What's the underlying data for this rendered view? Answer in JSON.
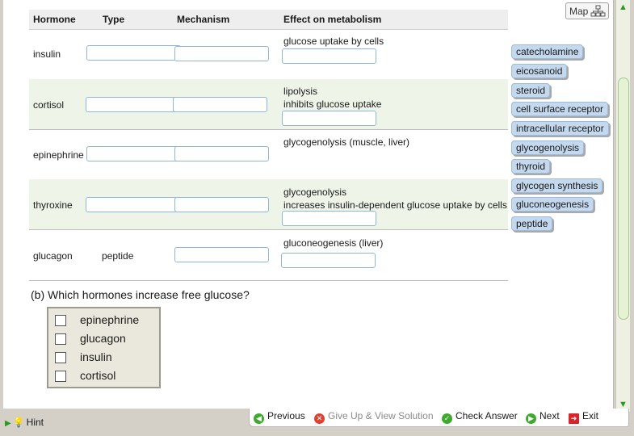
{
  "map_label": "Map",
  "table": {
    "headers": {
      "hormone": "Hormone",
      "type": "Type",
      "mechanism": "Mechanism",
      "effect": "Effect on metabolism"
    },
    "rows": [
      {
        "hormone": "insulin",
        "type": "",
        "effects": [
          "glucose uptake by cells"
        ]
      },
      {
        "hormone": "cortisol",
        "type": "",
        "effects": [
          "lipolysis",
          "inhibits glucose uptake"
        ]
      },
      {
        "hormone": "epinephrine",
        "type": "",
        "effects": [
          "glycogenolysis (muscle, liver)"
        ]
      },
      {
        "hormone": "thyroxine",
        "type": "",
        "effects": [
          "glycogenolysis",
          "increases insulin-dependent glucose uptake by cells"
        ]
      },
      {
        "hormone": "glucagon",
        "type": "peptide",
        "effects": [
          "gluconeogenesis (liver)"
        ]
      }
    ]
  },
  "tiles": [
    "catecholamine",
    "eicosanoid",
    "steroid",
    "cell surface receptor",
    "intracellular receptor",
    "glycogenolysis",
    "thyroid",
    "glycogen synthesis",
    "gluconeogenesis",
    "peptide"
  ],
  "question": "(b) Which hormones increase free glucose?",
  "checkbox_options": [
    "epinephrine",
    "glucagon",
    "insulin",
    "cortisol"
  ],
  "hint_label": "Hint",
  "nav": {
    "previous": "Previous",
    "give_up": "Give Up & View Solution",
    "check": "Check Answer",
    "next": "Next",
    "exit": "Exit"
  }
}
